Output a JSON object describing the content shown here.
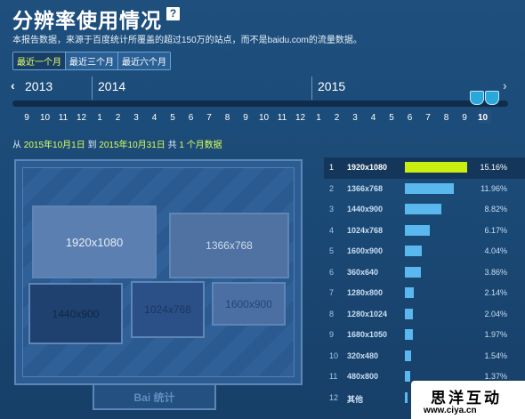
{
  "page": {
    "title": "分辨率使用情况",
    "help_glyph": "?",
    "description": "本报告数据，来源于百度统计所覆盖的超过150万的站点，而不是baidu.com的流量数据。"
  },
  "range_buttons": [
    "最近一个月",
    "最近三个月",
    "最近六个月"
  ],
  "timeline": {
    "prev_glyph": "‹",
    "next_glyph": "›",
    "years": [
      "2013",
      "2014",
      "2015"
    ],
    "months": [
      "9",
      "10",
      "11",
      "12",
      "1",
      "2",
      "3",
      "4",
      "5",
      "6",
      "7",
      "8",
      "9",
      "10",
      "11",
      "12",
      "1",
      "2",
      "3",
      "4",
      "5",
      "6",
      "7",
      "8",
      "9",
      "10"
    ],
    "selected_month": "10"
  },
  "period": {
    "from_label": "从",
    "start": "2015年10月1日",
    "to_label": "到",
    "end": "2015年10月31日",
    "total_label": "共",
    "count": "1",
    "suffix": "个月数据"
  },
  "monitor": {
    "boxes": [
      "1920x1080",
      "1366x768",
      "1440x900",
      "1024x768",
      "1600x900"
    ],
    "brand": "Bai 统计"
  },
  "ranking": [
    {
      "rank": "1",
      "name": "1920x1080",
      "pct": "15.16%",
      "value": 15.16
    },
    {
      "rank": "2",
      "name": "1366x768",
      "pct": "11.96%",
      "value": 11.96
    },
    {
      "rank": "3",
      "name": "1440x900",
      "pct": "8.82%",
      "value": 8.82
    },
    {
      "rank": "4",
      "name": "1024x768",
      "pct": "6.17%",
      "value": 6.17
    },
    {
      "rank": "5",
      "name": "1600x900",
      "pct": "4.04%",
      "value": 4.04
    },
    {
      "rank": "6",
      "name": "360x640",
      "pct": "3.86%",
      "value": 3.86
    },
    {
      "rank": "7",
      "name": "1280x800",
      "pct": "2.14%",
      "value": 2.14
    },
    {
      "rank": "8",
      "name": "1280x1024",
      "pct": "2.04%",
      "value": 2.04
    },
    {
      "rank": "9",
      "name": "1680x1050",
      "pct": "1.97%",
      "value": 1.97
    },
    {
      "rank": "10",
      "name": "320x480",
      "pct": "1.54%",
      "value": 1.54
    },
    {
      "rank": "11",
      "name": "480x800",
      "pct": "1.37%",
      "value": 1.37
    },
    {
      "rank": "12",
      "name": "其他",
      "pct": "",
      "value": 0.6
    }
  ],
  "watermark": {
    "title": "思洋互动",
    "url": "www.ciya.cn"
  }
}
